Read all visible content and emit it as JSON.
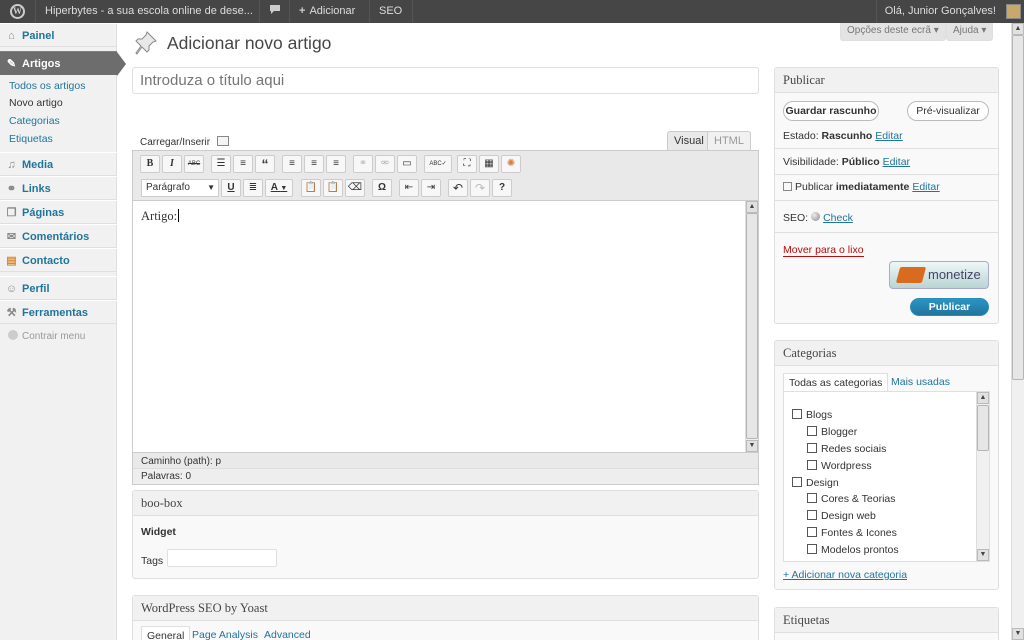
{
  "adminbar": {
    "wp_logo": "W",
    "site_name": "Hiperbytes - a sua escola online de dese...",
    "comments_icon": "comment-bubble-icon",
    "add_label": "Adicionar",
    "seo_label": "SEO",
    "howdy": "Olá, Junior Gonçalves!"
  },
  "menu": {
    "items": [
      {
        "label": "Painel",
        "icon": "home-icon"
      },
      {
        "label": "Artigos",
        "icon": "pin-icon"
      },
      {
        "label": "Media",
        "icon": "media-icon"
      },
      {
        "label": "Links",
        "icon": "link-icon"
      },
      {
        "label": "Páginas",
        "icon": "pages-icon"
      },
      {
        "label": "Comentários",
        "icon": "comments-icon"
      },
      {
        "label": "Contacto",
        "icon": "contact-icon"
      },
      {
        "label": "Perfil",
        "icon": "user-icon"
      },
      {
        "label": "Ferramentas",
        "icon": "tools-icon"
      }
    ],
    "sub": [
      "Todos os artigos",
      "Novo artigo",
      "Categorias",
      "Etiquetas"
    ],
    "collapse": "Contrair menu"
  },
  "screen_options": "Opções deste ecrã",
  "help": "Ajuda",
  "page_title": "Adicionar novo artigo",
  "title_placeholder": "Introduza o título aqui",
  "editor": {
    "upload_label": "Carregar/Inserir",
    "tab_visual": "Visual",
    "tab_html": "HTML",
    "format": "Parágrafo",
    "content": "Artigo:",
    "path_label": "Caminho (path):",
    "path_value": "p",
    "words": "Palavras: 0",
    "row1": [
      {
        "name": "bold-button",
        "glyph": "B",
        "disabled": false
      },
      {
        "name": "italic-button",
        "glyph": "I",
        "disabled": false
      },
      {
        "name": "strikethrough-button",
        "glyph": "ABC",
        "disabled": false
      },
      {
        "name": "bullet-list-button",
        "glyph": "☰",
        "disabled": false
      },
      {
        "name": "numbered-list-button",
        "glyph": "≡",
        "disabled": false
      },
      {
        "name": "blockquote-button",
        "glyph": "“",
        "disabled": false
      },
      {
        "name": "align-left-button",
        "glyph": "≡",
        "disabled": false
      },
      {
        "name": "align-center-button",
        "glyph": "≡",
        "disabled": false
      },
      {
        "name": "align-right-button",
        "glyph": "≡",
        "disabled": false
      },
      {
        "name": "insert-link-button",
        "glyph": "⚭",
        "disabled": true
      },
      {
        "name": "unlink-button",
        "glyph": "⚮",
        "disabled": true
      },
      {
        "name": "more-tag-button",
        "glyph": "▭",
        "disabled": false
      },
      {
        "name": "spellcheck-button",
        "glyph": "ABC✓",
        "disabled": false
      },
      {
        "name": "fullscreen-button",
        "glyph": "⛶",
        "disabled": false
      },
      {
        "name": "kitchen-sink-button",
        "glyph": "▦",
        "disabled": false
      },
      {
        "name": "plugin-button",
        "glyph": "✺",
        "disabled": false
      }
    ],
    "row2": [
      {
        "name": "underline-button",
        "glyph": "U",
        "disabled": false
      },
      {
        "name": "justify-button",
        "glyph": "≣",
        "disabled": false
      },
      {
        "name": "text-color-button",
        "glyph": "A",
        "disabled": false
      },
      {
        "name": "paste-text-button",
        "glyph": "📋",
        "disabled": false
      },
      {
        "name": "paste-word-button",
        "glyph": "📋",
        "disabled": false
      },
      {
        "name": "clear-format-button",
        "glyph": "⌫",
        "disabled": false
      },
      {
        "name": "special-char-button",
        "glyph": "Ω",
        "disabled": false
      },
      {
        "name": "outdent-button",
        "glyph": "⇤",
        "disabled": false
      },
      {
        "name": "indent-button",
        "glyph": "⇥",
        "disabled": false
      },
      {
        "name": "undo-button",
        "glyph": "↶",
        "disabled": false
      },
      {
        "name": "redo-button",
        "glyph": "↷",
        "disabled": true
      },
      {
        "name": "help-button",
        "glyph": "?",
        "disabled": false
      }
    ]
  },
  "boobox": {
    "title": "boo-box",
    "widget": "Widget",
    "tags_label": "Tags"
  },
  "seo_box": {
    "title": "WordPress SEO by Yoast",
    "tabs": [
      "General",
      "Page Analysis",
      "Advanced"
    ]
  },
  "publish": {
    "title": "Publicar",
    "save_draft": "Guardar rascunho",
    "preview": "Pré-visualizar",
    "status_label": "Estado:",
    "status_value": "Rascunho",
    "visibility_label": "Visibilidade:",
    "visibility_value": "Público",
    "schedule_label": "Publicar",
    "schedule_value": "imediatamente",
    "edit": "Editar",
    "seo_label": "SEO:",
    "seo_check": "Check",
    "trash": "Mover para o lixo",
    "monetize": "monetize",
    "publish_button": "Publicar"
  },
  "categories": {
    "title": "Categorias",
    "tab_all": "Todas as categorias",
    "tab_popular": "Mais usadas",
    "items": [
      {
        "label": "Blogs",
        "level": 0
      },
      {
        "label": "Blogger",
        "level": 1
      },
      {
        "label": "Redes sociais",
        "level": 1
      },
      {
        "label": "Wordpress",
        "level": 1
      },
      {
        "label": "Design",
        "level": 0
      },
      {
        "label": "Cores & Teorias",
        "level": 1
      },
      {
        "label": "Design web",
        "level": 1
      },
      {
        "label": "Fontes & Icones",
        "level": 1
      },
      {
        "label": "Modelos prontos",
        "level": 1
      }
    ],
    "add_new": "+ Adicionar nova categoria"
  },
  "tags_box": {
    "title": "Etiquetas"
  },
  "colors": {
    "link": "#21759b",
    "adminbar": "#464646",
    "menu_active": "#6d6d6d",
    "publish": "#21759b",
    "trash": "#bc0b0b"
  }
}
